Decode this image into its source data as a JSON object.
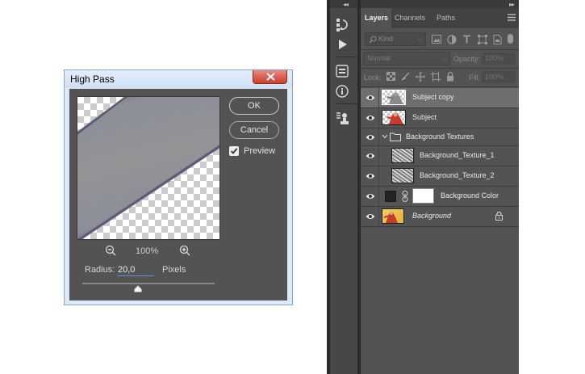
{
  "dialog": {
    "title": "High Pass",
    "ok_label": "OK",
    "cancel_label": "Cancel",
    "preview_label": "Preview",
    "preview_checked": true,
    "zoom_percent": "100%",
    "radius_label": "Radius:",
    "radius_value": "20,0",
    "unit_label": "Pixels"
  },
  "panel": {
    "tabs": [
      "Layers",
      "Channels",
      "Paths"
    ],
    "active_tab": "Layers",
    "filter_kind": "Kind",
    "blend_mode": "Normal",
    "opacity_label": "Opacity:",
    "opacity_value": "100%",
    "lock_label": "Lock:",
    "fill_label": "Fill:",
    "fill_value": "100%"
  },
  "layers": [
    {
      "name": "Subject copy",
      "thumb": "subject",
      "selected": true
    },
    {
      "name": "Subject",
      "thumb": "subject",
      "selected": false
    },
    {
      "name": "Background Textures",
      "thumb": "folder",
      "selected": false
    },
    {
      "name": "Background_Texture_1",
      "thumb": "texture",
      "selected": false
    },
    {
      "name": "Background_Texture_2",
      "thumb": "texture",
      "selected": false
    },
    {
      "name": "Background Color",
      "thumb": "color",
      "selected": false
    },
    {
      "name": "Background",
      "thumb": "background",
      "selected": false,
      "locked": true
    }
  ],
  "colors": {
    "dialog_bg": "#535353",
    "panel_bg": "#535353",
    "selected_layer": "#6e6e6e",
    "title_bar": "#dce9f7",
    "close_button": "#c8402f"
  }
}
